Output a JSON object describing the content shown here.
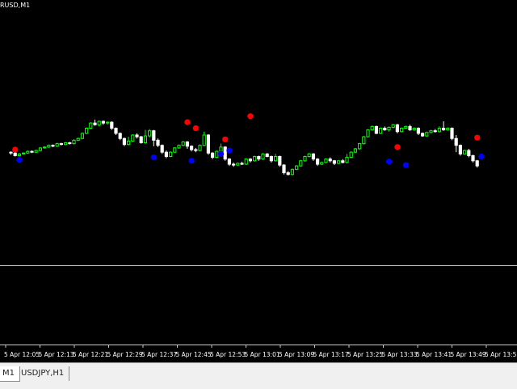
{
  "window": {
    "symbol_label": "RUSD,M1",
    "background": "#000000",
    "separator_color": "#c8c8c8"
  },
  "tabs": [
    {
      "label": "M1",
      "active": true
    },
    {
      "label": "USDJPY,H1",
      "active": false
    }
  ],
  "chart_data": {
    "type": "candlestick",
    "bull_color": "#00ff00",
    "bear_color": "#ffffff",
    "candles": [
      [
        1.3,
        1.29,
        1.31,
        1.27
      ],
      [
        1.29,
        1.26,
        1.3,
        1.25
      ],
      [
        1.26,
        1.28,
        1.29,
        1.25
      ],
      [
        1.28,
        1.29,
        1.3,
        1.27
      ],
      [
        1.29,
        1.31,
        1.32,
        1.28
      ],
      [
        1.31,
        1.3,
        1.32,
        1.29
      ],
      [
        1.3,
        1.32,
        1.33,
        1.29
      ],
      [
        1.32,
        1.35,
        1.36,
        1.31
      ],
      [
        1.35,
        1.36,
        1.37,
        1.34
      ],
      [
        1.36,
        1.38,
        1.39,
        1.35
      ],
      [
        1.38,
        1.37,
        1.39,
        1.36
      ],
      [
        1.37,
        1.4,
        1.41,
        1.36
      ],
      [
        1.4,
        1.39,
        1.41,
        1.38
      ],
      [
        1.39,
        1.41,
        1.42,
        1.38
      ],
      [
        1.41,
        1.4,
        1.42,
        1.39
      ],
      [
        1.4,
        1.44,
        1.45,
        1.39
      ],
      [
        1.44,
        1.46,
        1.47,
        1.43
      ],
      [
        1.46,
        1.52,
        1.53,
        1.45
      ],
      [
        1.52,
        1.58,
        1.59,
        1.51
      ],
      [
        1.58,
        1.64,
        1.65,
        1.57
      ],
      [
        1.64,
        1.62,
        1.68,
        1.61
      ],
      [
        1.62,
        1.66,
        1.67,
        1.6
      ],
      [
        1.66,
        1.64,
        1.67,
        1.62
      ],
      [
        1.64,
        1.65,
        1.66,
        1.62
      ],
      [
        1.65,
        1.58,
        1.66,
        1.56
      ],
      [
        1.58,
        1.52,
        1.59,
        1.5
      ],
      [
        1.52,
        1.46,
        1.53,
        1.44
      ],
      [
        1.46,
        1.39,
        1.47,
        1.37
      ],
      [
        1.39,
        1.43,
        1.48,
        1.38
      ],
      [
        1.43,
        1.5,
        1.51,
        1.42
      ],
      [
        1.5,
        1.48,
        1.52,
        1.46
      ],
      [
        1.48,
        1.41,
        1.49,
        1.4
      ],
      [
        1.41,
        1.49,
        1.56,
        1.4
      ],
      [
        1.49,
        1.55,
        1.57,
        1.47
      ],
      [
        1.55,
        1.44,
        1.56,
        1.37
      ],
      [
        1.44,
        1.38,
        1.46,
        1.36
      ],
      [
        1.38,
        1.3,
        1.39,
        1.28
      ],
      [
        1.3,
        1.25,
        1.32,
        1.23
      ],
      [
        1.25,
        1.3,
        1.31,
        1.24
      ],
      [
        1.3,
        1.35,
        1.36,
        1.29
      ],
      [
        1.35,
        1.38,
        1.39,
        1.34
      ],
      [
        1.38,
        1.42,
        1.43,
        1.37
      ],
      [
        1.42,
        1.37,
        1.43,
        1.34
      ],
      [
        1.37,
        1.33,
        1.38,
        1.31
      ],
      [
        1.33,
        1.32,
        1.35,
        1.3
      ],
      [
        1.32,
        1.38,
        1.39,
        1.31
      ],
      [
        1.38,
        1.5,
        1.54,
        1.37
      ],
      [
        1.5,
        1.29,
        1.51,
        1.27
      ],
      [
        1.29,
        1.24,
        1.3,
        1.22
      ],
      [
        1.24,
        1.31,
        1.32,
        1.23
      ],
      [
        1.31,
        1.36,
        1.4,
        1.3
      ],
      [
        1.36,
        1.22,
        1.37,
        1.2
      ],
      [
        1.22,
        1.16,
        1.23,
        1.14
      ],
      [
        1.16,
        1.15,
        1.18,
        1.13
      ],
      [
        1.15,
        1.17,
        1.18,
        1.14
      ],
      [
        1.17,
        1.16,
        1.19,
        1.15
      ],
      [
        1.16,
        1.22,
        1.23,
        1.15
      ],
      [
        1.22,
        1.2,
        1.23,
        1.18
      ],
      [
        1.2,
        1.25,
        1.26,
        1.19
      ],
      [
        1.25,
        1.22,
        1.26,
        1.2
      ],
      [
        1.22,
        1.28,
        1.29,
        1.21
      ],
      [
        1.28,
        1.25,
        1.29,
        1.24
      ],
      [
        1.25,
        1.2,
        1.26,
        1.18
      ],
      [
        1.2,
        1.25,
        1.28,
        1.19
      ],
      [
        1.25,
        1.15,
        1.26,
        1.13
      ],
      [
        1.15,
        1.06,
        1.16,
        1.04
      ],
      [
        1.06,
        1.04,
        1.08,
        1.03
      ],
      [
        1.04,
        1.1,
        1.11,
        1.03
      ],
      [
        1.1,
        1.14,
        1.15,
        1.09
      ],
      [
        1.14,
        1.2,
        1.21,
        1.13
      ],
      [
        1.2,
        1.25,
        1.26,
        1.19
      ],
      [
        1.25,
        1.28,
        1.29,
        1.24
      ],
      [
        1.28,
        1.22,
        1.29,
        1.2
      ],
      [
        1.22,
        1.16,
        1.23,
        1.14
      ],
      [
        1.16,
        1.18,
        1.19,
        1.15
      ],
      [
        1.18,
        1.22,
        1.23,
        1.17
      ],
      [
        1.22,
        1.2,
        1.24,
        1.18
      ],
      [
        1.2,
        1.17,
        1.21,
        1.15
      ],
      [
        1.17,
        1.2,
        1.21,
        1.16
      ],
      [
        1.2,
        1.18,
        1.22,
        1.17
      ],
      [
        1.18,
        1.24,
        1.28,
        1.17
      ],
      [
        1.24,
        1.3,
        1.31,
        1.23
      ],
      [
        1.3,
        1.34,
        1.35,
        1.29
      ],
      [
        1.34,
        1.4,
        1.41,
        1.33
      ],
      [
        1.4,
        1.48,
        1.49,
        1.39
      ],
      [
        1.48,
        1.56,
        1.57,
        1.47
      ],
      [
        1.56,
        1.6,
        1.61,
        1.55
      ],
      [
        1.6,
        1.52,
        1.61,
        1.51
      ],
      [
        1.52,
        1.58,
        1.59,
        1.51
      ],
      [
        1.58,
        1.56,
        1.6,
        1.55
      ],
      [
        1.56,
        1.59,
        1.6,
        1.54
      ],
      [
        1.59,
        1.62,
        1.63,
        1.58
      ],
      [
        1.62,
        1.54,
        1.63,
        1.52
      ],
      [
        1.54,
        1.58,
        1.59,
        1.53
      ],
      [
        1.58,
        1.6,
        1.61,
        1.57
      ],
      [
        1.6,
        1.56,
        1.62,
        1.55
      ],
      [
        1.56,
        1.58,
        1.59,
        1.55
      ],
      [
        1.58,
        1.52,
        1.59,
        1.5
      ],
      [
        1.52,
        1.49,
        1.53,
        1.48
      ],
      [
        1.49,
        1.53,
        1.54,
        1.48
      ],
      [
        1.53,
        1.55,
        1.56,
        1.52
      ],
      [
        1.55,
        1.54,
        1.57,
        1.53
      ],
      [
        1.54,
        1.58,
        1.6,
        1.53
      ],
      [
        1.58,
        1.56,
        1.66,
        1.55
      ],
      [
        1.56,
        1.58,
        1.59,
        1.55
      ],
      [
        1.58,
        1.46,
        1.59,
        1.44
      ],
      [
        1.46,
        1.38,
        1.5,
        1.3
      ],
      [
        1.38,
        1.28,
        1.39,
        1.26
      ],
      [
        1.28,
        1.32,
        1.33,
        1.27
      ],
      [
        1.32,
        1.26,
        1.34,
        1.24
      ],
      [
        1.26,
        1.2,
        1.27,
        1.18
      ],
      [
        1.2,
        1.14,
        1.21,
        1.12
      ]
    ],
    "signals": [
      {
        "bar": 1,
        "type": "sell",
        "price": 1.33
      },
      {
        "bar": 2,
        "type": "buy",
        "price": 1.21
      },
      {
        "bar": 34,
        "type": "buy",
        "price": 1.24
      },
      {
        "bar": 42,
        "type": "sell",
        "price": 1.65
      },
      {
        "bar": 43,
        "type": "buy",
        "price": 1.2
      },
      {
        "bar": 44,
        "type": "sell",
        "price": 1.58
      },
      {
        "bar": 50,
        "type": "buy",
        "price": 1.28
      },
      {
        "bar": 51,
        "type": "sell",
        "price": 1.45
      },
      {
        "bar": 52,
        "type": "buy",
        "price": 1.32
      },
      {
        "bar": 57,
        "type": "sell",
        "price": 1.72
      },
      {
        "bar": 90,
        "type": "buy",
        "price": 1.19
      },
      {
        "bar": 92,
        "type": "sell",
        "price": 1.36
      },
      {
        "bar": 94,
        "type": "buy",
        "price": 1.15
      },
      {
        "bar": 111,
        "type": "sell",
        "price": 1.47
      },
      {
        "bar": 112,
        "type": "buy",
        "price": 1.25
      },
      {
        "bar": 122,
        "type": "sell",
        "price": 1.67
      }
    ],
    "signal_colors": {
      "buy": "#0000ff",
      "sell": "#ff0000"
    },
    "x_tick_labels": [
      "5 Apr 12:05",
      "5 Apr 12:13",
      "5 Apr 12:21",
      "5 Apr 12:29",
      "5 Apr 12:37",
      "5 Apr 12:45",
      "5 Apr 12:53",
      "5 Apr 13:01",
      "5 Apr 13:09",
      "5 Apr 13:17",
      "5 Apr 13:25",
      "5 Apr 13:33",
      "5 Apr 13:41",
      "5 Apr 13:49",
      "5 Apr 13:57"
    ],
    "grid": false
  }
}
